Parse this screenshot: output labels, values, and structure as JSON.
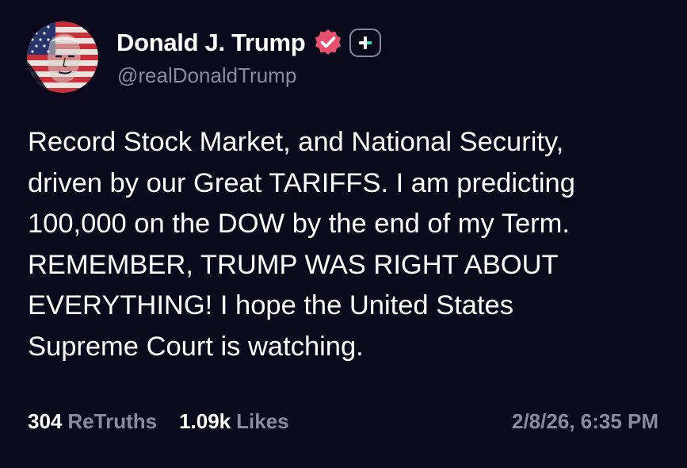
{
  "author": {
    "display_name": "Donald J. Trump",
    "handle": "@realDonaldTrump",
    "verified": true,
    "avatar_icon": "flag-portrait-avatar",
    "badge_icon": "plus-badge-icon"
  },
  "post": {
    "lines": [
      "Record Stock Market, and National Security,",
      "driven by our Great TARIFFS. I am predicting",
      "100,000 on the DOW by the end of my Term.",
      "REMEMBER, TRUMP WAS RIGHT ABOUT",
      "EVERYTHING! I hope the United States",
      "Supreme Court is watching."
    ]
  },
  "stats": {
    "retruths_count": "304",
    "retruths_label": "ReTruths",
    "likes_count": "1.09k",
    "likes_label": "Likes"
  },
  "timestamp": "2/8/26, 6:35 PM",
  "colors": {
    "background": "#0b0a1c",
    "text": "#ffffff",
    "muted": "#8c8aa0",
    "verified": "#e8506e"
  }
}
